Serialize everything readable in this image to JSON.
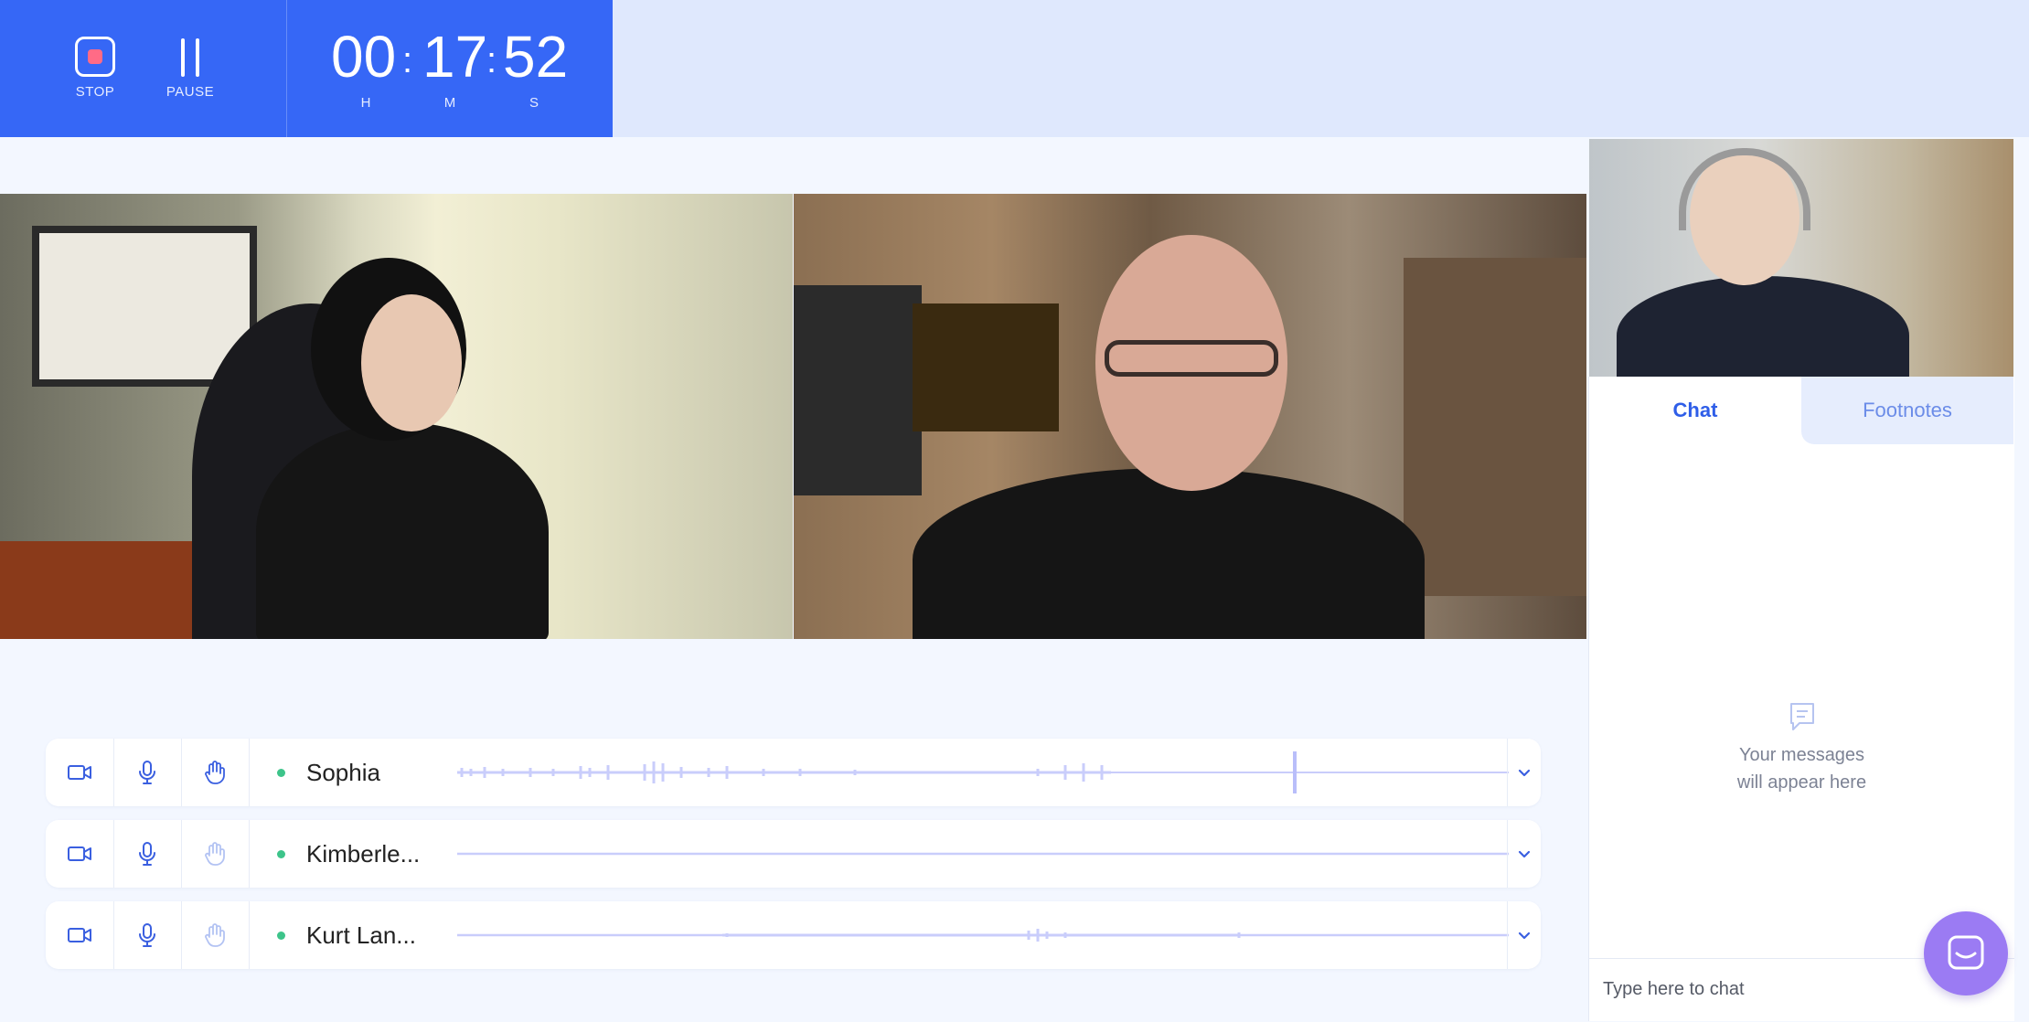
{
  "recorder": {
    "stop_label": "STOP",
    "pause_label": "PAUSE",
    "hours": "00",
    "minutes": "17",
    "seconds": "52",
    "h_label": "H",
    "m_label": "M",
    "s_label": "S"
  },
  "participants": [
    {
      "name": "Sophia",
      "hand_active": true
    },
    {
      "name": "Kimberle...",
      "hand_active": false
    },
    {
      "name": "Kurt Lan...",
      "hand_active": false
    }
  ],
  "sidebar": {
    "tabs": [
      {
        "label": "Chat",
        "active": true
      },
      {
        "label": "Footnotes",
        "active": false
      }
    ],
    "empty_line1": "Your messages",
    "empty_line2": "will appear here",
    "chat_placeholder": "Type here to chat"
  },
  "colors": {
    "accent": "#3667f6",
    "status_online": "#3dc48a",
    "wave": "#c9cdfb",
    "launcher": "#9b7bf3"
  }
}
